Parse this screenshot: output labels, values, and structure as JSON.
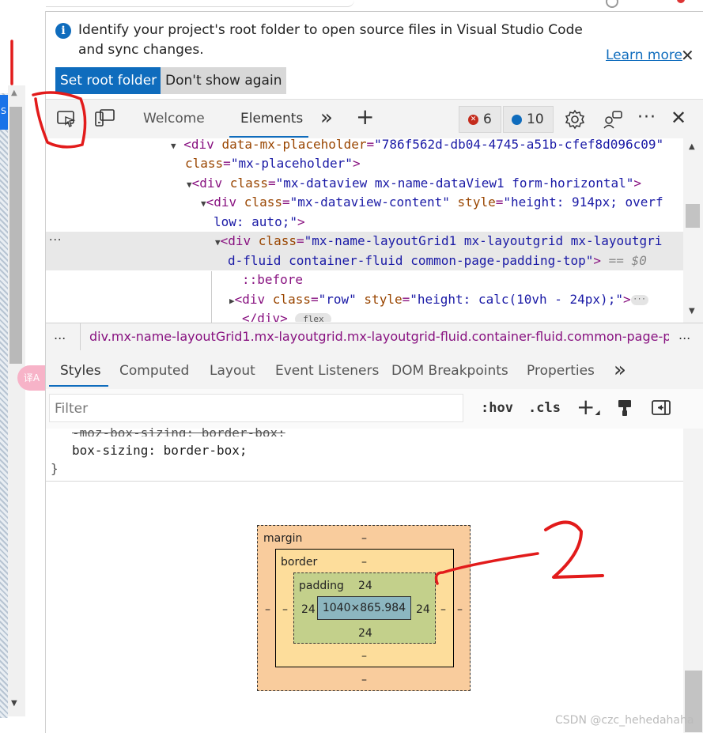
{
  "infobar": {
    "message": "Identify your project's root folder to open source files in Visual Studio Code and sync changes.",
    "set_root": "Set root folder",
    "dont_show": "Don't show again",
    "learn_more": "Learn more",
    "close": "✕"
  },
  "toolbar": {
    "tabs": [
      "Welcome",
      "Elements"
    ],
    "more": "»",
    "add": "+",
    "errors": "6",
    "messages": "10",
    "more_menu": "···",
    "close": "✕"
  },
  "dom": {
    "line1_open": "<div ",
    "line1_attr": "data-mx-placeholder",
    "line1_val": "\"786f562d-db04-4745-a51b-cfef8d096c09\"",
    "line2_attr": "class",
    "line2_val": "\"mx-placeholder\"",
    "line3_attr": "class",
    "line3_val": "\"mx-dataview mx-name-dataView1 form-horizontal\"",
    "line4_attr1": "class",
    "line4_val1": "\"mx-dataview-content\"",
    "line4_attr2": "style",
    "line4_val2a": "\"height: 914px; overf",
    "line4_val2b": "low: auto;\"",
    "line5_attr": "class",
    "line5_val_a": "\"mx-name-layoutGrid1 mx-layoutgrid mx-layoutgri",
    "line5_val_b": "d-fluid container-fluid common-page-padding-top\"",
    "line5_eq": "== $0",
    "line6": "::before",
    "line7_attr1": "class",
    "line7_val1": "\"row\"",
    "line7_attr2": "style",
    "line7_val2": "\"height: calc(10vh - 24px);\"",
    "line8": "</div>",
    "flex_badge": "flex",
    "gutter_dots": "···"
  },
  "breadcrumb": {
    "left_more": "...",
    "path": "div.mx-name-layoutGrid1.mx-layoutgrid.mx-layoutgrid-fluid.container-fluid.common-page-p",
    "right_more": "..."
  },
  "styles_tabs": [
    "Styles",
    "Computed",
    "Layout",
    "Event Listeners",
    "DOM Breakpoints",
    "Properties"
  ],
  "styles_more": "»",
  "filter": {
    "placeholder": "Filter",
    "hov": ":hov",
    "cls": ".cls"
  },
  "css": {
    "strike_line": "-moz-box-sizing: border-box;",
    "prop": "box-sizing",
    "value": "border-box;",
    "close_brace": "}"
  },
  "boxmodel": {
    "margin_label": "margin",
    "margin_top": "–",
    "margin_left": "–",
    "margin_right": "–",
    "margin_bottom": "–",
    "border_label": "border",
    "border_top": "–",
    "border_left": "–",
    "border_right": "–",
    "border_bottom": "–",
    "padding_label": "padding",
    "padding_top": "24",
    "padding_left": "24",
    "padding_right": "24",
    "padding_bottom": "24",
    "content": "1040×865.984"
  },
  "annotations": {
    "mark1": "1",
    "mark2": "2"
  },
  "watermark": "CSDN @czc_hehedahaha",
  "left_strip": {
    "blue_label": "S",
    "translate": "译A"
  }
}
